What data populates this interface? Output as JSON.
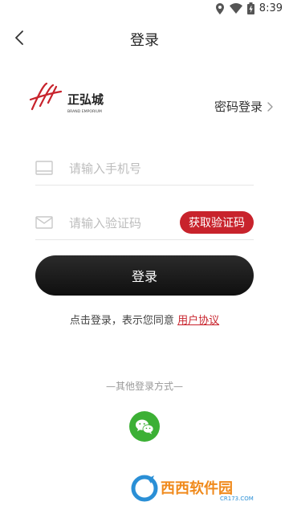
{
  "status_bar": {
    "time": "8:39"
  },
  "header": {
    "title": "登录"
  },
  "brand": {
    "logo_text": "正弘城",
    "logo_subtext": "BRAND EMPORIUM"
  },
  "password_login": {
    "label": "密码登录"
  },
  "phone_field": {
    "placeholder": "请输入手机号",
    "value": ""
  },
  "code_field": {
    "placeholder": "请输入验证码",
    "value": ""
  },
  "get_code_button": {
    "label": "获取验证码"
  },
  "login_button": {
    "label": "登录"
  },
  "agreement": {
    "text": "点击登录，表示您同意 ",
    "link": "用户协议"
  },
  "other_login": {
    "label": "—其他登录方式—"
  },
  "watermark": {
    "text": "西西软件园",
    "subtext": "CR173.COM"
  },
  "colors": {
    "accent": "#c8232c",
    "wechat": "#3cb035",
    "button_dark": "#1a1a1a"
  }
}
